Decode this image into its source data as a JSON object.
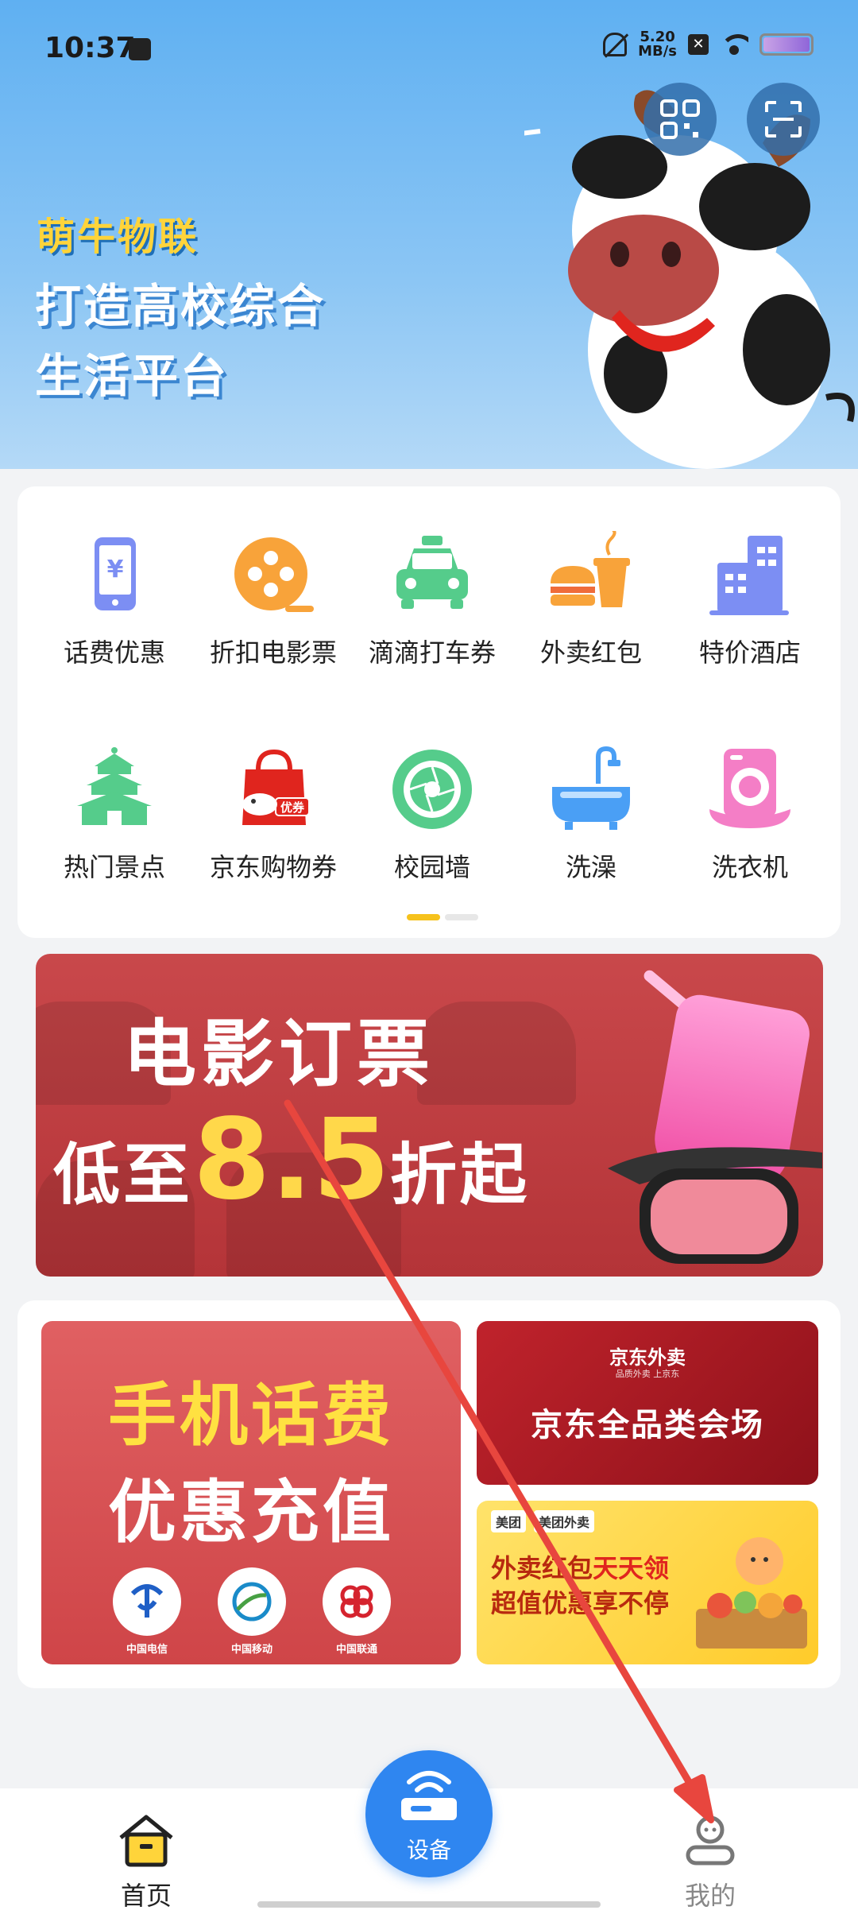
{
  "status_bar": {
    "time": "10:37",
    "net_speed_value": "5.20",
    "net_speed_unit": "MB/s"
  },
  "hero": {
    "brand": "萌牛物联",
    "tagline_line1": "打造高校综合",
    "tagline_line2": "生活平台"
  },
  "grid": {
    "items": [
      {
        "label": "话费优惠",
        "icon": "phone-yen-icon"
      },
      {
        "label": "折扣电影票",
        "icon": "film-reel-icon"
      },
      {
        "label": "滴滴打车券",
        "icon": "taxi-icon"
      },
      {
        "label": "外卖红包",
        "icon": "burger-drink-icon"
      },
      {
        "label": "特价酒店",
        "icon": "hotel-building-icon"
      },
      {
        "label": "热门景点",
        "icon": "temple-icon"
      },
      {
        "label": "京东购物券",
        "icon": "shopping-bag-icon"
      },
      {
        "label": "校园墙",
        "icon": "shutter-icon"
      },
      {
        "label": "洗澡",
        "icon": "bathtub-icon"
      },
      {
        "label": "洗衣机",
        "icon": "washing-machine-icon"
      }
    ]
  },
  "movie_banner": {
    "line1": "电影订票",
    "line2_prefix": "低至",
    "line2_value": "8.5",
    "line2_suffix": "折起"
  },
  "phone_card": {
    "line1": "手机话费",
    "line2": "优惠充值",
    "carriers": [
      "中国电信",
      "中国移动",
      "中国联通"
    ]
  },
  "jd_card": {
    "logo": "京东外卖",
    "logo_sub": "品质外卖 上京东",
    "title": "京东全品类会场"
  },
  "meituan_card": {
    "logo1": "美团",
    "logo2": "美团外卖",
    "line1_prefix": "外卖红包",
    "line1_highlight": "天天领",
    "line2": "超值优惠享不停"
  },
  "tabbar": {
    "home": "首页",
    "device": "设备",
    "mine": "我的"
  },
  "colors": {
    "accent_blue": "#2f86f0",
    "hero_blue": "#5fb0f2",
    "brand_yellow": "#ffd43a",
    "annotation_red": "#e8463e"
  }
}
